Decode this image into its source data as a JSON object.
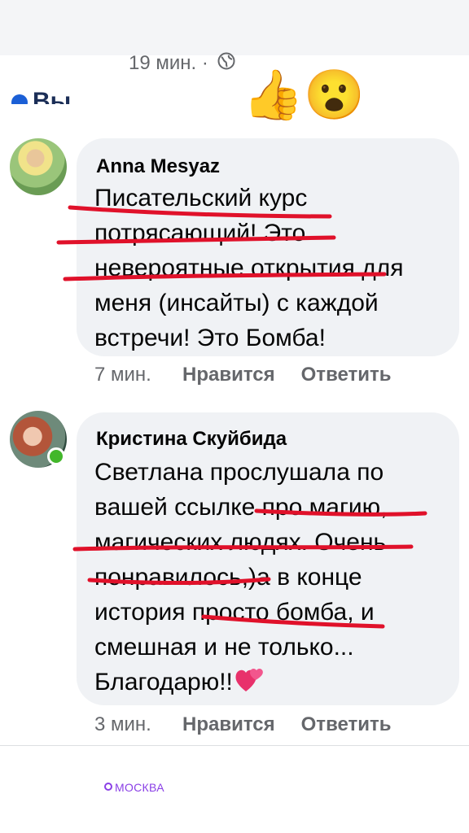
{
  "header": {
    "time": "19 мин.",
    "separator": "·",
    "partial_label": "Вы"
  },
  "reactions": {
    "thumb": "👍",
    "wow": "😮"
  },
  "comments": [
    {
      "author": "Anna Mesyaz",
      "text": "Писательский курс потрясающий! Это невероятные открытия для меня (инсайты) с каждой встречи! Это Бомба!",
      "time": "7 мин.",
      "like": "Нравится",
      "reply": "Ответить",
      "online": false
    },
    {
      "author": "Кристина Скуйбида",
      "text": "Светлана прослушала по вашей ссылке про магию, магических людях. Очень понравилось,)а в конце история просто бомба, и смешная и не только...",
      "text_end": "Благодарю!!",
      "emoji": "💕",
      "time": "3 мин.",
      "like": "Нравится",
      "reply": "Ответить",
      "online": true
    }
  ],
  "footer": {
    "location": "МОСКВА"
  },
  "colors": {
    "bubble": "#f0f2f5",
    "meta_text": "#65676b",
    "underline": "#e0112a",
    "online": "#42b72a",
    "location": "#8a3fe6"
  }
}
